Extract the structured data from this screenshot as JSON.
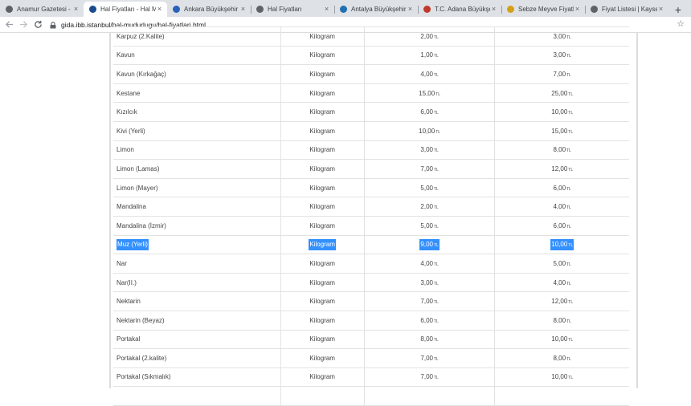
{
  "browser": {
    "tabs": [
      {
        "title": "Anamur Gazetesi - S",
        "favicon": "gray-circle-icon",
        "favicon_color": "#5f6368",
        "active": false
      },
      {
        "title": "Hal Fiyatları - Hal M",
        "favicon": "ibb-logo-icon",
        "favicon_color": "#1a4b8c",
        "active": true
      },
      {
        "title": "Ankara Büyükşehir B",
        "favicon": "ankara-logo-icon",
        "favicon_color": "#2a62b8",
        "active": false
      },
      {
        "title": "Hal Fiyatları",
        "favicon": "globe-icon",
        "favicon_color": "#5f6368",
        "active": false
      },
      {
        "title": "Antalya Büyükşehir B",
        "favicon": "antalya-logo-icon",
        "favicon_color": "#1f6fb2",
        "active": false
      },
      {
        "title": "T.C. Adana Büyükşeh",
        "favicon": "adana-logo-icon",
        "favicon_color": "#c0392b",
        "active": false
      },
      {
        "title": "Sebze Meyve Fiyatla",
        "favicon": "medal-icon",
        "favicon_color": "#d4a017",
        "active": false
      },
      {
        "title": "Fiyat Listesi | Kayser",
        "favicon": "globe-icon",
        "favicon_color": "#5f6368",
        "active": false
      }
    ],
    "close_glyph": "×",
    "new_tab_glyph": "+",
    "url": "gida.ibb.istanbul/hal-mudurlugu/hal-fiyatlari.html"
  },
  "currency": "TL",
  "table": {
    "rows": [
      {
        "name": "Karpuz (2.Kalite)",
        "unit": "Kilogram",
        "min": "2,00",
        "max": "3,00"
      },
      {
        "name": "Kavun",
        "unit": "Kilogram",
        "min": "1,00",
        "max": "3,00"
      },
      {
        "name": "Kavun (Kırkağaç)",
        "unit": "Kilogram",
        "min": "4,00",
        "max": "7,00"
      },
      {
        "name": "Kestane",
        "unit": "Kilogram",
        "min": "15,00",
        "max": "25,00"
      },
      {
        "name": "Kızılcık",
        "unit": "Kilogram",
        "min": "6,00",
        "max": "10,00"
      },
      {
        "name": "Kivi (Yerli)",
        "unit": "Kilogram",
        "min": "10,00",
        "max": "15,00"
      },
      {
        "name": "Limon",
        "unit": "Kilogram",
        "min": "3,00",
        "max": "8,00"
      },
      {
        "name": "Limon (Lamas)",
        "unit": "Kilogram",
        "min": "7,00",
        "max": "12,00"
      },
      {
        "name": "Limon (Mayer)",
        "unit": "Kilogram",
        "min": "5,00",
        "max": "6,00"
      },
      {
        "name": "Mandalina",
        "unit": "Kilogram",
        "min": "2,00",
        "max": "4,00"
      },
      {
        "name": "Mandalina (İzmir)",
        "unit": "Kilogram",
        "min": "5,00",
        "max": "6,00"
      },
      {
        "name": "Muz (Yerli)",
        "unit": "Kilogram",
        "min": "9,00",
        "max": "10,00",
        "selected": true
      },
      {
        "name": "Nar",
        "unit": "Kilogram",
        "min": "4,00",
        "max": "5,00"
      },
      {
        "name": "Nar(II.)",
        "unit": "Kilogram",
        "min": "3,00",
        "max": "4,00"
      },
      {
        "name": "Nektarin",
        "unit": "Kilogram",
        "min": "7,00",
        "max": "12,00"
      },
      {
        "name": "Nektarin (Beyaz)",
        "unit": "Kilogram",
        "min": "6,00",
        "max": "8,00"
      },
      {
        "name": "Portakal",
        "unit": "Kilogram",
        "min": "8,00",
        "max": "10,00"
      },
      {
        "name": "Portakal (2.kalite)",
        "unit": "Kilogram",
        "min": "7,00",
        "max": "8,00"
      },
      {
        "name": "Portakal (Sıkmalık)",
        "unit": "Kilogram",
        "min": "7,00",
        "max": "10,00"
      },
      {
        "name": "",
        "unit": "",
        "min": "",
        "max": ""
      }
    ]
  },
  "colors": {
    "selection": "#3390ff",
    "tabstrip": "#dee1e6"
  }
}
